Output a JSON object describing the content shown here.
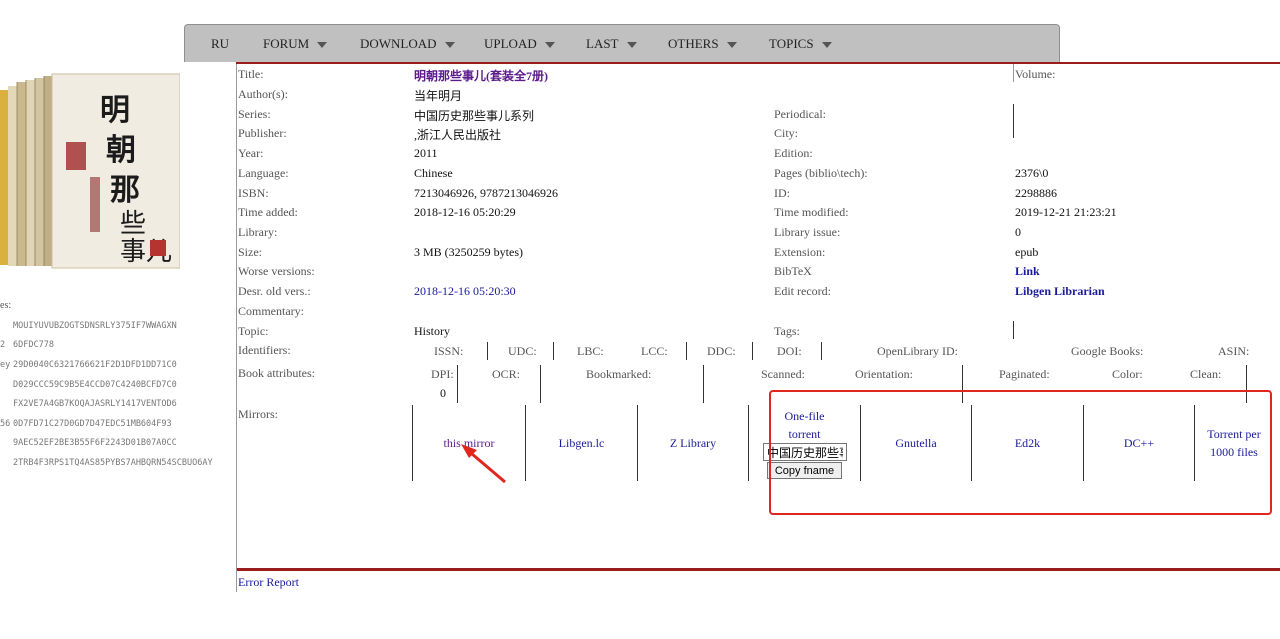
{
  "menu": {
    "items": [
      {
        "label": "RU",
        "dropdown": false
      },
      {
        "label": "FORUM",
        "dropdown": true
      },
      {
        "label": "DOWNLOAD",
        "dropdown": true
      },
      {
        "label": "UPLOAD",
        "dropdown": true
      },
      {
        "label": "LAST",
        "dropdown": true
      },
      {
        "label": "OTHERS",
        "dropdown": true
      },
      {
        "label": "TOPICS",
        "dropdown": true
      }
    ]
  },
  "hashes": {
    "label": "es:",
    "rows": [
      {
        "prefix": "",
        "value": "MOUIYUVUBZOGTSDNSRLY375IF7WWAGXN"
      },
      {
        "prefix": "2",
        "value": "6DFDC778"
      },
      {
        "prefix": "ey",
        "value": "29D0040C6321766621F2D1DFD1DD71C0"
      },
      {
        "prefix": "",
        "value": "D029CCC59C9B5E4CCD07C4240BCFD7C0"
      },
      {
        "prefix": "",
        "value": "FX2VE7A4GB7KOQAJASRLY1417VENTOD6"
      },
      {
        "prefix": "56",
        "value": "0D7FD71C27D0GD7D47EDC51MB604F93"
      },
      {
        "prefix": "",
        "value": "9AEC52EF2BE3B55F6F2243D01B07A0CC"
      },
      {
        "prefix": "",
        "value": "2TRB4F3RPS1TQ4AS85PYBS7AHBQRN54SCBUO6AY"
      }
    ]
  },
  "book": {
    "left": [
      {
        "label": "Title:",
        "value": "明朝那些事儿(套装全7册)"
      },
      {
        "label": "Author(s):",
        "value": "当年明月"
      },
      {
        "label": "Series:",
        "value": "中国历史那些事儿系列"
      },
      {
        "label": "Publisher:",
        "value": ",浙江人民出版社"
      },
      {
        "label": "Year:",
        "value": "2011"
      },
      {
        "label": "Language:",
        "value": "Chinese"
      },
      {
        "label": "ISBN:",
        "value": "7213046926, 9787213046926"
      },
      {
        "label": "Time added:",
        "value": "2018-12-16 05:20:29"
      },
      {
        "label": "Library:",
        "value": ""
      },
      {
        "label": "Size:",
        "value": "3 MB (3250259 bytes)"
      },
      {
        "label": "Worse versions:",
        "value": ""
      },
      {
        "label": "Desr. old vers.:",
        "value": "2018-12-16 05:20:30"
      },
      {
        "label": "Commentary:",
        "value": ""
      },
      {
        "label": "Topic:",
        "value": "History"
      }
    ],
    "right": [
      {
        "label": "Volume:",
        "value": ""
      },
      {
        "label": "Periodical:",
        "value": ""
      },
      {
        "label": "City:",
        "value": ""
      },
      {
        "label": "Edition:",
        "value": ""
      },
      {
        "label": "Pages (biblio\\tech):",
        "value": "2376\\0"
      },
      {
        "label": "ID:",
        "value": "2298886"
      },
      {
        "label": "Time modified:",
        "value": "2019-12-21 21:23:21"
      },
      {
        "label": "Library issue:",
        "value": "0"
      },
      {
        "label": "Extension:",
        "value": "epub"
      },
      {
        "label": "BibTeX",
        "value": "Link"
      },
      {
        "label": "Edit record:",
        "value": "Libgen Librarian"
      },
      {
        "label": "Tags:",
        "value": ""
      }
    ]
  },
  "identifiers": {
    "label": "Identifiers:",
    "items": [
      "ISSN:",
      "UDC:",
      "LBC:",
      "LCC:",
      "DDC:",
      "DOI:",
      "OpenLibrary ID:",
      "Google Books:",
      "ASIN:"
    ]
  },
  "attributes": {
    "label": "Book attributes:",
    "items": [
      "DPI:",
      "OCR:",
      "Bookmarked:",
      "Scanned:",
      "Orientation:",
      "Paginated:",
      "Color:",
      "Clean:"
    ],
    "dpi_value": "0"
  },
  "mirrors": {
    "label": "Mirrors:",
    "this_mirror": "this mirror",
    "libgen": "Libgen.lc",
    "zlib": "Z Library",
    "onefile_1": "One-file",
    "onefile_2": "torrent",
    "filename_value": "中国历史那些事",
    "copy_label": "Copy fname",
    "gnutella": "Gnutella",
    "ed2k": "Ed2k",
    "dc": "DC++",
    "torrent_1": "Torrent per",
    "torrent_2": "1000 files"
  },
  "footer": {
    "error_report": "Error Report"
  },
  "colors": {
    "rule": "#9b1c1c",
    "link": "#1a1a9c",
    "annotation": "#e0261d"
  }
}
